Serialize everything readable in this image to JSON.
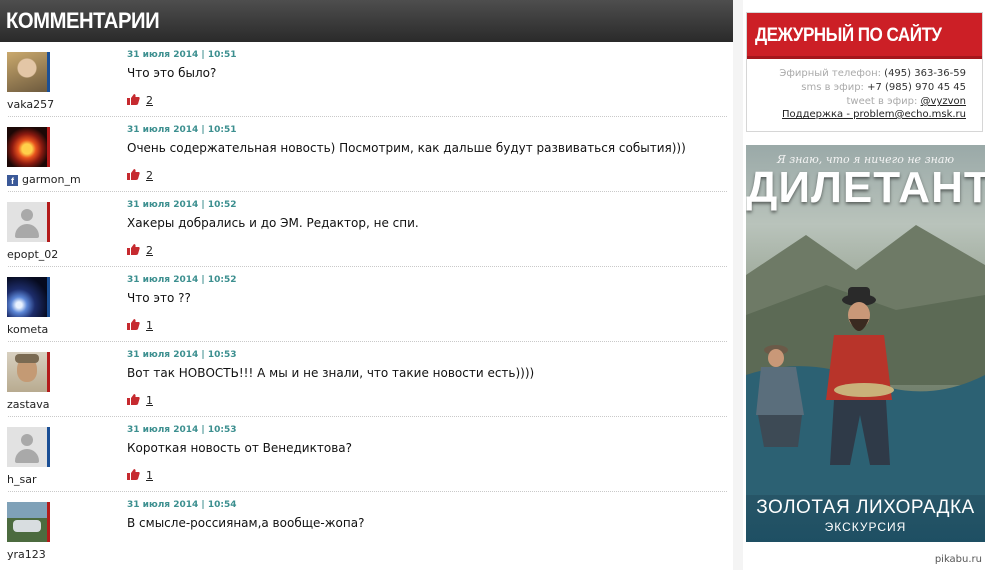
{
  "header": {
    "title": "КОММЕНТАРИИ"
  },
  "comments": [
    {
      "user": "vaka257",
      "date": "31 июля 2014 | 10:51",
      "text": "Что это было?",
      "likes": "2",
      "facebook": false,
      "avatar": "photo-woman"
    },
    {
      "user": "garmon_m",
      "date": "31 июля 2014 | 10:51",
      "text": "Очень содержательная новость) Посмотрим, как дальше будут развиваться события)))",
      "likes": "2",
      "facebook": true,
      "avatar": "fire"
    },
    {
      "user": "epopt_02",
      "date": "31 июля 2014 | 10:52",
      "text": "Хакеры добрались и до ЭМ. Редактор, не спи.",
      "likes": "2",
      "facebook": false,
      "avatar": "default"
    },
    {
      "user": "kometa",
      "date": "31 июля 2014 | 10:52",
      "text": "Что это ??",
      "likes": "1",
      "facebook": false,
      "avatar": "comet"
    },
    {
      "user": "zastava",
      "date": "31 июля 2014 | 10:53",
      "text": "Вот так НОВОСТЬ!!! А мы и не знали, что такие новости есть))))",
      "likes": "1",
      "facebook": false,
      "avatar": "man"
    },
    {
      "user": "h_sar",
      "date": "31 июля 2014 | 10:53",
      "text": "Короткая новость от Венедиктова?",
      "likes": "1",
      "facebook": false,
      "avatar": "default"
    },
    {
      "user": "yra123",
      "date": "31 июля 2014 | 10:54",
      "text": "В смысле-россиянам,а вообще-жопа?",
      "likes": "",
      "facebook": false,
      "avatar": "car"
    }
  ],
  "duty": {
    "title": "ДЕЖУРНЫЙ ПО САЙТУ",
    "phone_label": "Эфирный телефон:",
    "phone": "(495) 363-36-59",
    "sms_label": "sms в эфир:",
    "sms": "+7 (985) 970 45 45",
    "tweet_label": "tweet в эфир:",
    "tweet": "@vyzvon",
    "support": "Поддержка - problem@echo.msk.ru"
  },
  "ad": {
    "tagline": "Я знаю, что я ничего не знаю",
    "brand": "ДИЛЕТАНТ",
    "title": "ЗОЛОТАЯ ЛИХОРАДКА",
    "subtitle": "ЭКСКУРСИЯ"
  },
  "watermark": "pikabu.ru",
  "colors": {
    "accent_red": "#cc1f26",
    "date_teal": "#3c8f8f",
    "header_dark": "#333333"
  }
}
